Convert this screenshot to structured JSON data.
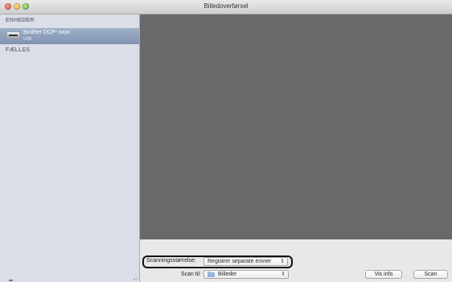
{
  "window": {
    "title": "Billedoverførsel"
  },
  "sidebar": {
    "devices_header": "ENHEDER",
    "device": {
      "name": "Brother DCP- xxxx",
      "connection": "USB"
    },
    "shared_header": "FÆLLES"
  },
  "controls": {
    "scan_size_label": "Scanningsstørrelse:",
    "scan_size_value": "Registrer separate emner",
    "scan_to_label": "Scan til:",
    "scan_to_value": "Billeder",
    "vis_info_label": "Vis info",
    "scan_label": "Scan"
  },
  "colors": {
    "preview_bg": "#69696b",
    "sidebar_bg": "#d9dee7",
    "selection": "#8a9dbb"
  },
  "icons": {
    "popup_arrows": "⇕",
    "folder": "folder-icon",
    "device": "scanner-icon"
  }
}
